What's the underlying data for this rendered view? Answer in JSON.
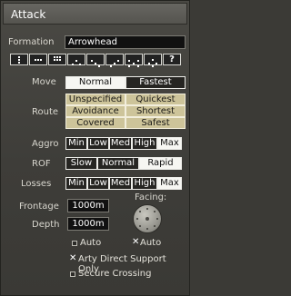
{
  "window": {
    "title": "Attack"
  },
  "formation": {
    "label": "Formation",
    "value": "Arrowhead",
    "help_label": "?"
  },
  "move": {
    "label": "Move",
    "options": [
      "Normal",
      "Fastest"
    ]
  },
  "route": {
    "label": "Route",
    "options": [
      "Unspecified",
      "Quickest",
      "Avoidance",
      "Shortest",
      "Covered",
      "Safest"
    ]
  },
  "aggro": {
    "label": "Aggro",
    "options": [
      "Min",
      "Low",
      "Med",
      "High",
      "Max"
    ]
  },
  "rof": {
    "label": "ROF",
    "options": [
      "Slow",
      "Normal",
      "Rapid"
    ]
  },
  "losses": {
    "label": "Losses",
    "options": [
      "Min",
      "Low",
      "Med",
      "High",
      "Max"
    ]
  },
  "frontage": {
    "label": "Frontage",
    "value": "1000m"
  },
  "depth": {
    "label": "Depth",
    "value": "1000m"
  },
  "facing": {
    "label": "Facing:"
  },
  "auto_left": {
    "label": "Auto"
  },
  "auto_right": {
    "label": "Auto"
  },
  "arty": {
    "label": "Arty Direct Support Only"
  },
  "secure": {
    "label": "Secure Crossing"
  },
  "colors": {
    "selected": "#f6f6f2",
    "unselected": "#262522",
    "route_fill": "#cdc49a"
  }
}
